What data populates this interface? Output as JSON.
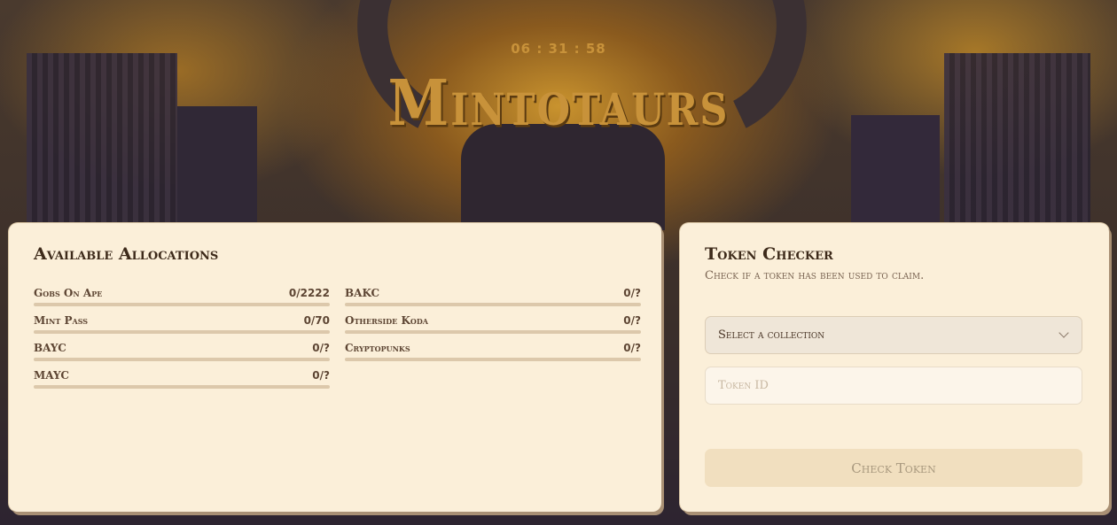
{
  "timer": {
    "hours": "06",
    "minutes": "31",
    "seconds": "58",
    "display": "06 : 31 : 58"
  },
  "brand": {
    "logo_text": "Mintotaurs",
    "accent_color": "#c8923a"
  },
  "allocations": {
    "title": "Available Allocations",
    "left_column": [
      {
        "name": "Gobs On Ape",
        "count": "0/2222",
        "progress": 0
      },
      {
        "name": "Mint Pass",
        "count": "0/70",
        "progress": 0
      },
      {
        "name": "BAYC",
        "count": "0/?",
        "progress": 0
      },
      {
        "name": "MAYC",
        "count": "0/?",
        "progress": 0
      }
    ],
    "right_column": [
      {
        "name": "BAKC",
        "count": "0/?",
        "progress": 0
      },
      {
        "name": "Otherside Koda",
        "count": "0/?",
        "progress": 0
      },
      {
        "name": "Cryptopunks",
        "count": "0/?",
        "progress": 0
      }
    ]
  },
  "token_checker": {
    "title": "Token Checker",
    "subtitle": "Check if a token has been used to claim.",
    "select_value": "Select a collection",
    "token_placeholder": "Token ID",
    "button_label": "Check Token"
  }
}
